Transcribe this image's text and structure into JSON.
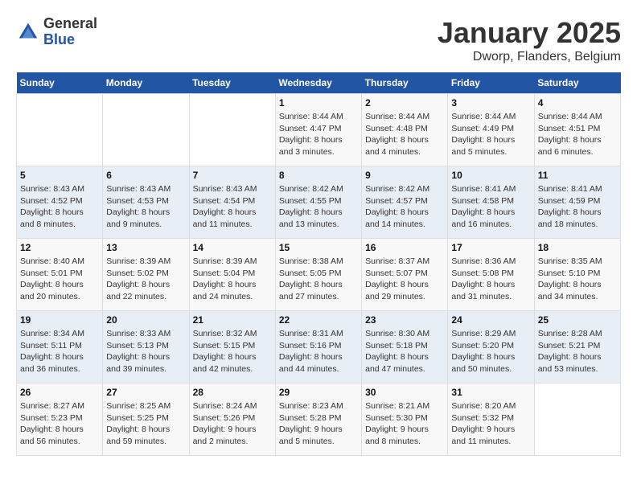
{
  "logo": {
    "general": "General",
    "blue": "Blue"
  },
  "header": {
    "title": "January 2025",
    "subtitle": "Dworp, Flanders, Belgium"
  },
  "days_of_week": [
    "Sunday",
    "Monday",
    "Tuesday",
    "Wednesday",
    "Thursday",
    "Friday",
    "Saturday"
  ],
  "weeks": [
    [
      {
        "day": "",
        "sunrise": "",
        "sunset": "",
        "daylight": ""
      },
      {
        "day": "",
        "sunrise": "",
        "sunset": "",
        "daylight": ""
      },
      {
        "day": "",
        "sunrise": "",
        "sunset": "",
        "daylight": ""
      },
      {
        "day": "1",
        "sunrise": "Sunrise: 8:44 AM",
        "sunset": "Sunset: 4:47 PM",
        "daylight": "Daylight: 8 hours and 3 minutes."
      },
      {
        "day": "2",
        "sunrise": "Sunrise: 8:44 AM",
        "sunset": "Sunset: 4:48 PM",
        "daylight": "Daylight: 8 hours and 4 minutes."
      },
      {
        "day": "3",
        "sunrise": "Sunrise: 8:44 AM",
        "sunset": "Sunset: 4:49 PM",
        "daylight": "Daylight: 8 hours and 5 minutes."
      },
      {
        "day": "4",
        "sunrise": "Sunrise: 8:44 AM",
        "sunset": "Sunset: 4:51 PM",
        "daylight": "Daylight: 8 hours and 6 minutes."
      }
    ],
    [
      {
        "day": "5",
        "sunrise": "Sunrise: 8:43 AM",
        "sunset": "Sunset: 4:52 PM",
        "daylight": "Daylight: 8 hours and 8 minutes."
      },
      {
        "day": "6",
        "sunrise": "Sunrise: 8:43 AM",
        "sunset": "Sunset: 4:53 PM",
        "daylight": "Daylight: 8 hours and 9 minutes."
      },
      {
        "day": "7",
        "sunrise": "Sunrise: 8:43 AM",
        "sunset": "Sunset: 4:54 PM",
        "daylight": "Daylight: 8 hours and 11 minutes."
      },
      {
        "day": "8",
        "sunrise": "Sunrise: 8:42 AM",
        "sunset": "Sunset: 4:55 PM",
        "daylight": "Daylight: 8 hours and 13 minutes."
      },
      {
        "day": "9",
        "sunrise": "Sunrise: 8:42 AM",
        "sunset": "Sunset: 4:57 PM",
        "daylight": "Daylight: 8 hours and 14 minutes."
      },
      {
        "day": "10",
        "sunrise": "Sunrise: 8:41 AM",
        "sunset": "Sunset: 4:58 PM",
        "daylight": "Daylight: 8 hours and 16 minutes."
      },
      {
        "day": "11",
        "sunrise": "Sunrise: 8:41 AM",
        "sunset": "Sunset: 4:59 PM",
        "daylight": "Daylight: 8 hours and 18 minutes."
      }
    ],
    [
      {
        "day": "12",
        "sunrise": "Sunrise: 8:40 AM",
        "sunset": "Sunset: 5:01 PM",
        "daylight": "Daylight: 8 hours and 20 minutes."
      },
      {
        "day": "13",
        "sunrise": "Sunrise: 8:39 AM",
        "sunset": "Sunset: 5:02 PM",
        "daylight": "Daylight: 8 hours and 22 minutes."
      },
      {
        "day": "14",
        "sunrise": "Sunrise: 8:39 AM",
        "sunset": "Sunset: 5:04 PM",
        "daylight": "Daylight: 8 hours and 24 minutes."
      },
      {
        "day": "15",
        "sunrise": "Sunrise: 8:38 AM",
        "sunset": "Sunset: 5:05 PM",
        "daylight": "Daylight: 8 hours and 27 minutes."
      },
      {
        "day": "16",
        "sunrise": "Sunrise: 8:37 AM",
        "sunset": "Sunset: 5:07 PM",
        "daylight": "Daylight: 8 hours and 29 minutes."
      },
      {
        "day": "17",
        "sunrise": "Sunrise: 8:36 AM",
        "sunset": "Sunset: 5:08 PM",
        "daylight": "Daylight: 8 hours and 31 minutes."
      },
      {
        "day": "18",
        "sunrise": "Sunrise: 8:35 AM",
        "sunset": "Sunset: 5:10 PM",
        "daylight": "Daylight: 8 hours and 34 minutes."
      }
    ],
    [
      {
        "day": "19",
        "sunrise": "Sunrise: 8:34 AM",
        "sunset": "Sunset: 5:11 PM",
        "daylight": "Daylight: 8 hours and 36 minutes."
      },
      {
        "day": "20",
        "sunrise": "Sunrise: 8:33 AM",
        "sunset": "Sunset: 5:13 PM",
        "daylight": "Daylight: 8 hours and 39 minutes."
      },
      {
        "day": "21",
        "sunrise": "Sunrise: 8:32 AM",
        "sunset": "Sunset: 5:15 PM",
        "daylight": "Daylight: 8 hours and 42 minutes."
      },
      {
        "day": "22",
        "sunrise": "Sunrise: 8:31 AM",
        "sunset": "Sunset: 5:16 PM",
        "daylight": "Daylight: 8 hours and 44 minutes."
      },
      {
        "day": "23",
        "sunrise": "Sunrise: 8:30 AM",
        "sunset": "Sunset: 5:18 PM",
        "daylight": "Daylight: 8 hours and 47 minutes."
      },
      {
        "day": "24",
        "sunrise": "Sunrise: 8:29 AM",
        "sunset": "Sunset: 5:20 PM",
        "daylight": "Daylight: 8 hours and 50 minutes."
      },
      {
        "day": "25",
        "sunrise": "Sunrise: 8:28 AM",
        "sunset": "Sunset: 5:21 PM",
        "daylight": "Daylight: 8 hours and 53 minutes."
      }
    ],
    [
      {
        "day": "26",
        "sunrise": "Sunrise: 8:27 AM",
        "sunset": "Sunset: 5:23 PM",
        "daylight": "Daylight: 8 hours and 56 minutes."
      },
      {
        "day": "27",
        "sunrise": "Sunrise: 8:25 AM",
        "sunset": "Sunset: 5:25 PM",
        "daylight": "Daylight: 8 hours and 59 minutes."
      },
      {
        "day": "28",
        "sunrise": "Sunrise: 8:24 AM",
        "sunset": "Sunset: 5:26 PM",
        "daylight": "Daylight: 9 hours and 2 minutes."
      },
      {
        "day": "29",
        "sunrise": "Sunrise: 8:23 AM",
        "sunset": "Sunset: 5:28 PM",
        "daylight": "Daylight: 9 hours and 5 minutes."
      },
      {
        "day": "30",
        "sunrise": "Sunrise: 8:21 AM",
        "sunset": "Sunset: 5:30 PM",
        "daylight": "Daylight: 9 hours and 8 minutes."
      },
      {
        "day": "31",
        "sunrise": "Sunrise: 8:20 AM",
        "sunset": "Sunset: 5:32 PM",
        "daylight": "Daylight: 9 hours and 11 minutes."
      },
      {
        "day": "",
        "sunrise": "",
        "sunset": "",
        "daylight": ""
      }
    ]
  ]
}
